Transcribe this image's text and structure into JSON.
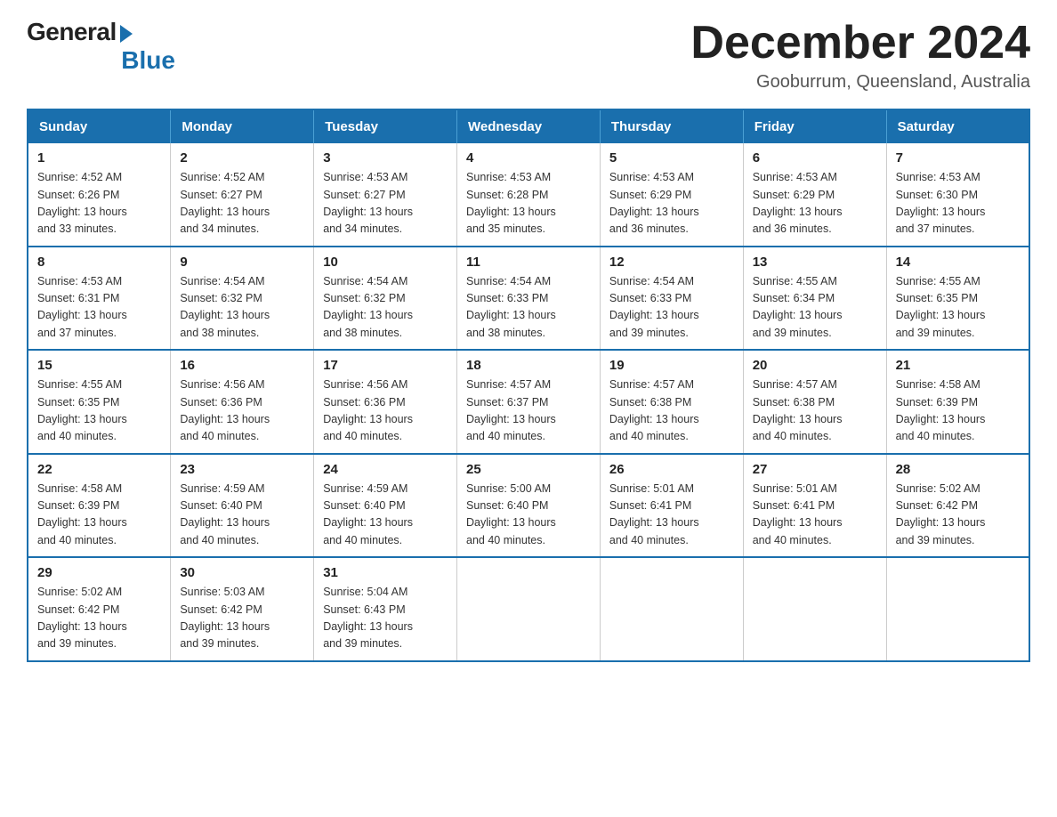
{
  "logo": {
    "general": "General",
    "blue": "Blue"
  },
  "title": "December 2024",
  "location": "Gooburrum, Queensland, Australia",
  "headers": [
    "Sunday",
    "Monday",
    "Tuesday",
    "Wednesday",
    "Thursday",
    "Friday",
    "Saturday"
  ],
  "weeks": [
    [
      {
        "day": "1",
        "sunrise": "4:52 AM",
        "sunset": "6:26 PM",
        "daylight": "13 hours and 33 minutes."
      },
      {
        "day": "2",
        "sunrise": "4:52 AM",
        "sunset": "6:27 PM",
        "daylight": "13 hours and 34 minutes."
      },
      {
        "day": "3",
        "sunrise": "4:53 AM",
        "sunset": "6:27 PM",
        "daylight": "13 hours and 34 minutes."
      },
      {
        "day": "4",
        "sunrise": "4:53 AM",
        "sunset": "6:28 PM",
        "daylight": "13 hours and 35 minutes."
      },
      {
        "day": "5",
        "sunrise": "4:53 AM",
        "sunset": "6:29 PM",
        "daylight": "13 hours and 36 minutes."
      },
      {
        "day": "6",
        "sunrise": "4:53 AM",
        "sunset": "6:29 PM",
        "daylight": "13 hours and 36 minutes."
      },
      {
        "day": "7",
        "sunrise": "4:53 AM",
        "sunset": "6:30 PM",
        "daylight": "13 hours and 37 minutes."
      }
    ],
    [
      {
        "day": "8",
        "sunrise": "4:53 AM",
        "sunset": "6:31 PM",
        "daylight": "13 hours and 37 minutes."
      },
      {
        "day": "9",
        "sunrise": "4:54 AM",
        "sunset": "6:32 PM",
        "daylight": "13 hours and 38 minutes."
      },
      {
        "day": "10",
        "sunrise": "4:54 AM",
        "sunset": "6:32 PM",
        "daylight": "13 hours and 38 minutes."
      },
      {
        "day": "11",
        "sunrise": "4:54 AM",
        "sunset": "6:33 PM",
        "daylight": "13 hours and 38 minutes."
      },
      {
        "day": "12",
        "sunrise": "4:54 AM",
        "sunset": "6:33 PM",
        "daylight": "13 hours and 39 minutes."
      },
      {
        "day": "13",
        "sunrise": "4:55 AM",
        "sunset": "6:34 PM",
        "daylight": "13 hours and 39 minutes."
      },
      {
        "day": "14",
        "sunrise": "4:55 AM",
        "sunset": "6:35 PM",
        "daylight": "13 hours and 39 minutes."
      }
    ],
    [
      {
        "day": "15",
        "sunrise": "4:55 AM",
        "sunset": "6:35 PM",
        "daylight": "13 hours and 40 minutes."
      },
      {
        "day": "16",
        "sunrise": "4:56 AM",
        "sunset": "6:36 PM",
        "daylight": "13 hours and 40 minutes."
      },
      {
        "day": "17",
        "sunrise": "4:56 AM",
        "sunset": "6:36 PM",
        "daylight": "13 hours and 40 minutes."
      },
      {
        "day": "18",
        "sunrise": "4:57 AM",
        "sunset": "6:37 PM",
        "daylight": "13 hours and 40 minutes."
      },
      {
        "day": "19",
        "sunrise": "4:57 AM",
        "sunset": "6:38 PM",
        "daylight": "13 hours and 40 minutes."
      },
      {
        "day": "20",
        "sunrise": "4:57 AM",
        "sunset": "6:38 PM",
        "daylight": "13 hours and 40 minutes."
      },
      {
        "day": "21",
        "sunrise": "4:58 AM",
        "sunset": "6:39 PM",
        "daylight": "13 hours and 40 minutes."
      }
    ],
    [
      {
        "day": "22",
        "sunrise": "4:58 AM",
        "sunset": "6:39 PM",
        "daylight": "13 hours and 40 minutes."
      },
      {
        "day": "23",
        "sunrise": "4:59 AM",
        "sunset": "6:40 PM",
        "daylight": "13 hours and 40 minutes."
      },
      {
        "day": "24",
        "sunrise": "4:59 AM",
        "sunset": "6:40 PM",
        "daylight": "13 hours and 40 minutes."
      },
      {
        "day": "25",
        "sunrise": "5:00 AM",
        "sunset": "6:40 PM",
        "daylight": "13 hours and 40 minutes."
      },
      {
        "day": "26",
        "sunrise": "5:01 AM",
        "sunset": "6:41 PM",
        "daylight": "13 hours and 40 minutes."
      },
      {
        "day": "27",
        "sunrise": "5:01 AM",
        "sunset": "6:41 PM",
        "daylight": "13 hours and 40 minutes."
      },
      {
        "day": "28",
        "sunrise": "5:02 AM",
        "sunset": "6:42 PM",
        "daylight": "13 hours and 39 minutes."
      }
    ],
    [
      {
        "day": "29",
        "sunrise": "5:02 AM",
        "sunset": "6:42 PM",
        "daylight": "13 hours and 39 minutes."
      },
      {
        "day": "30",
        "sunrise": "5:03 AM",
        "sunset": "6:42 PM",
        "daylight": "13 hours and 39 minutes."
      },
      {
        "day": "31",
        "sunrise": "5:04 AM",
        "sunset": "6:43 PM",
        "daylight": "13 hours and 39 minutes."
      },
      null,
      null,
      null,
      null
    ]
  ],
  "labels": {
    "sunrise": "Sunrise:",
    "sunset": "Sunset:",
    "daylight": "Daylight:"
  }
}
